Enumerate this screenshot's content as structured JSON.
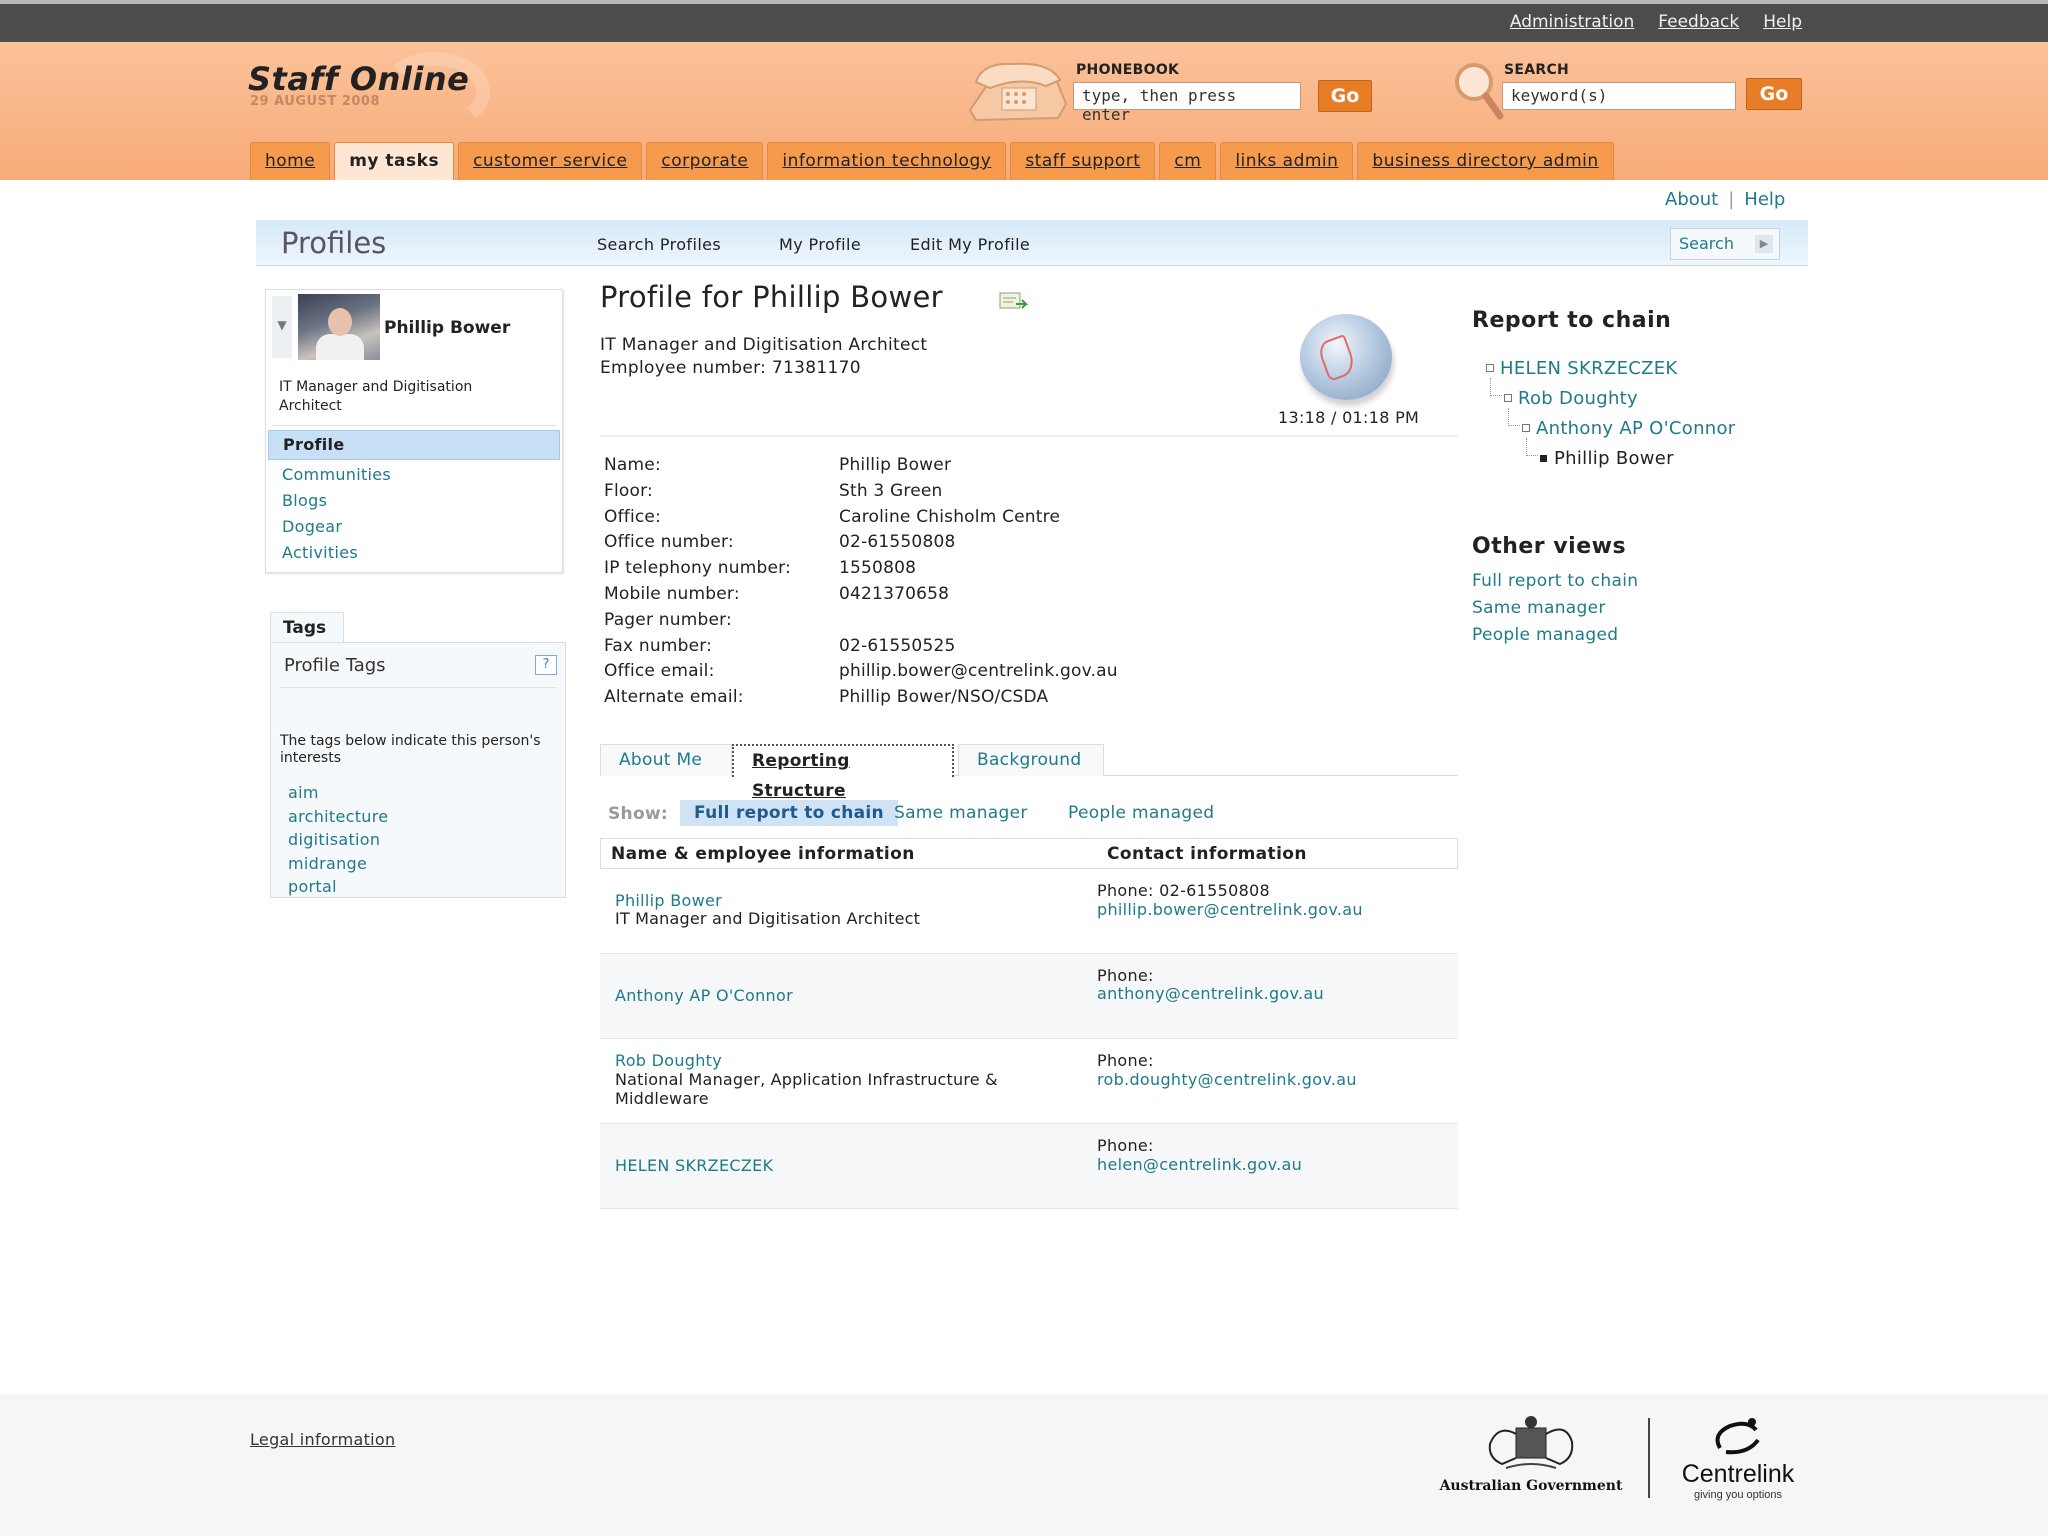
{
  "topbar": {
    "links": [
      "Administration",
      "Feedback",
      "Help"
    ]
  },
  "header": {
    "logo_title": "Staff Online",
    "logo_date": "29 AUGUST 2008",
    "phonebook_label": "PHONEBOOK",
    "phonebook_value": "type, then press enter",
    "search_label": "SEARCH",
    "search_value": "keyword(s)",
    "go_label": "Go",
    "accent_color": "#f69a4e"
  },
  "mainnav": [
    "home",
    "my tasks",
    "customer service",
    "corporate",
    "information technology",
    "staff support",
    "cm",
    "links admin",
    "business directory admin"
  ],
  "util": {
    "about": "About",
    "help": "Help"
  },
  "profbar": {
    "title": "Profiles",
    "links": [
      "Search Profiles",
      "My Profile",
      "Edit My Profile"
    ],
    "search_button": "Search"
  },
  "card": {
    "name": "Phillip Bower",
    "title": "IT Manager and Digitisation Architect",
    "nav": [
      "Profile",
      "Communities",
      "Blogs",
      "Dogear",
      "Activities"
    ]
  },
  "tags": {
    "tab": "Tags",
    "title": "Profile Tags",
    "help": "?",
    "description": "The tags below indicate this person's interests",
    "items": [
      "aim",
      "architecture",
      "digitisation",
      "midrange",
      "portal"
    ]
  },
  "profile": {
    "heading": "Profile for Phillip Bower",
    "subtitle": "IT Manager and Digitisation Architect",
    "employee_number": "Employee number: 71381170",
    "time": "13:18 / 01:18 PM",
    "fields": [
      {
        "label": "Name:",
        "value": "Phillip Bower"
      },
      {
        "label": "Floor:",
        "value": "Sth 3 Green"
      },
      {
        "label": "Office:",
        "value": "Caroline Chisholm Centre"
      },
      {
        "label": "Office number:",
        "value": "02-61550808"
      },
      {
        "label": "IP telephony number:",
        "value": "1550808"
      },
      {
        "label": "Mobile number:",
        "value": "0421370658"
      },
      {
        "label": "Pager number:",
        "value": ""
      },
      {
        "label": "Fax number:",
        "value": "02-61550525"
      },
      {
        "label": "Office email:",
        "value": "phillip.bower@centrelink.gov.au"
      },
      {
        "label": "Alternate email:",
        "value": "Phillip Bower/NSO/CSDA"
      }
    ]
  },
  "subtabs": [
    "About Me",
    "Reporting Structure",
    "Background"
  ],
  "show": {
    "label": "Show:",
    "options": [
      "Full report to chain",
      "Same manager",
      "People managed"
    ]
  },
  "report_table": {
    "headers": [
      "Name & employee information",
      "Contact information"
    ],
    "rows": [
      {
        "name": "Phillip Bower",
        "title": "IT Manager and Digitisation Architect",
        "phone": "Phone: 02-61550808",
        "email": "phillip.bower@centrelink.gov.au"
      },
      {
        "name": "Anthony AP O'Connor",
        "title": "",
        "phone": "Phone:",
        "email": "anthony@centrelink.gov.au"
      },
      {
        "name": "Rob Doughty",
        "title": "National Manager, Application Infrastructure & Middleware",
        "phone": "Phone:",
        "email": "rob.doughty@centrelink.gov.au"
      },
      {
        "name": "HELEN SKRZECZEK",
        "title": "",
        "phone": "Phone:",
        "email": "helen@centrelink.gov.au"
      }
    ]
  },
  "chain": {
    "title": "Report to chain",
    "nodes": [
      "HELEN SKRZECZEK",
      "Rob Doughty",
      "Anthony AP O'Connor",
      "Phillip Bower"
    ]
  },
  "other_views": {
    "title": "Other views",
    "links": [
      "Full report to chain",
      "Same manager",
      "People managed"
    ]
  },
  "footer": {
    "legal": "Legal information",
    "gov": "Australian Government",
    "brand": "Centrelink",
    "tagline": "giving you options"
  }
}
